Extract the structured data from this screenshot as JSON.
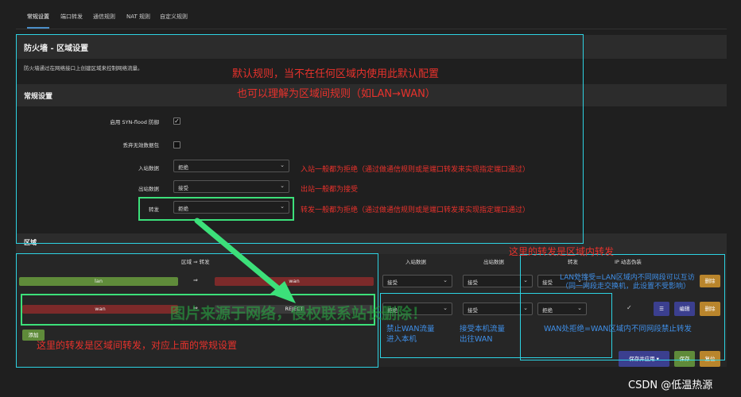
{
  "tabs": [
    "常规设置",
    "端口转发",
    "通信规则",
    "NAT 规则",
    "自定义规则"
  ],
  "page": {
    "title": "防火墙 - 区域设置",
    "description": "防火墙通过在网络接口上创建区域来控制网络流量。"
  },
  "general": {
    "title": "常规设置",
    "syn_label": "启用 SYN-flood 防御",
    "drop_label": "丢弃无效数据包",
    "input_label": "入站数据",
    "input_value": "拒绝",
    "output_label": "出站数据",
    "output_value": "接受",
    "forward_label": "转发",
    "forward_value": "拒绝"
  },
  "zones": {
    "title": "区域",
    "col_zone": "区域 ⇒ 转发",
    "col_input": "入站数据",
    "col_output": "出站数据",
    "col_forward": "转发",
    "col_masq": "IP 动态伪装",
    "rows": [
      {
        "name": "lan",
        "arrow": "⇒",
        "target": "wan",
        "input": "接受",
        "output": "接受",
        "forward": "接受",
        "masq": "",
        "edit": "编辑",
        "delete": "删除"
      },
      {
        "name": "wan",
        "arrow": "⇒",
        "target": "REJECT",
        "input": "拒绝",
        "output": "接受",
        "forward": "拒绝",
        "masq": "✓",
        "edit": "编辑",
        "delete": "删除",
        "menu": "☰"
      }
    ],
    "add_label": "添加"
  },
  "footer": {
    "save_apply": "保存并应用",
    "save": "保存",
    "reset": "复位"
  },
  "annotations": {
    "default_rule_1": "默认规则，当不在任何区域内使用此默认配置",
    "default_rule_2": "也可以理解为区域间规则（如LAN→WAN）",
    "input_note": "入站一般都为拒绝（通过做通信规则或是端口转发来实现指定端口通过）",
    "output_note": "出站一般都为接受",
    "forward_note": "转发一般都为拒绝（通过做通信规则或是端口转发来实现指定端口通过）",
    "intra_zone": "这里的转发是区域内转发",
    "lan_accept_1": "LAN处接受=LAN区域内不同网段可以互访",
    "lan_accept_2": "（同一网段走交换机，此设置不受影响）",
    "wan_reject": "WAN处拒绝=WAN区域内不同网段禁止转发",
    "inter_zone": "这里的转发是区域间转发，对应上面的常规设置",
    "deny_wan_1": "禁止WAN流量",
    "deny_wan_2": "进入本机",
    "accept_out_1": "接受本机流量",
    "accept_out_2": "出往WAN",
    "watermark": "图片来源于网络，侵权联系站长删除！",
    "csdn": "CSDN @低温热源"
  },
  "colors": {
    "lan": "#5f8b3a",
    "wan": "#7c2a2a",
    "cyan": "#2dd3e3",
    "green": "#3ce07a",
    "red_annotation": "#e8322c",
    "blue_annotation": "#3f8fe8"
  }
}
